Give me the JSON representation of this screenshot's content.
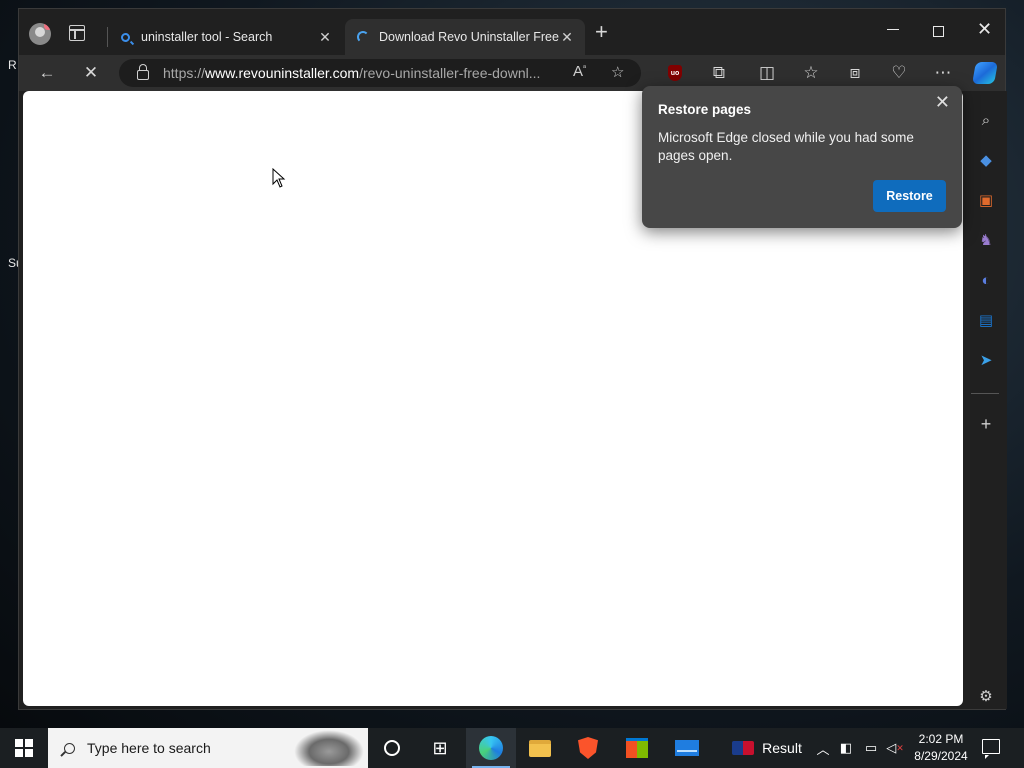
{
  "desktop": {
    "frag1": "R",
    "frag2": "Su"
  },
  "tabs": [
    {
      "title": "uninstaller tool - Search"
    },
    {
      "title": "Download Revo Uninstaller Freew"
    }
  ],
  "address": {
    "scheme": "https://",
    "host": "www.revouninstaller.com",
    "path": "/revo-uninstaller-free-downl..."
  },
  "popup": {
    "title": "Restore pages",
    "message": "Microsoft Edge closed while you had some pages open.",
    "button": "Restore"
  },
  "taskbar": {
    "search_placeholder": "Type here to search",
    "result_label": "Result",
    "time": "2:02 PM",
    "date": "8/29/2024"
  },
  "colors": {
    "accent": "#0f6cbd",
    "chrome": "#2f2f2f",
    "popup": "#474747"
  }
}
